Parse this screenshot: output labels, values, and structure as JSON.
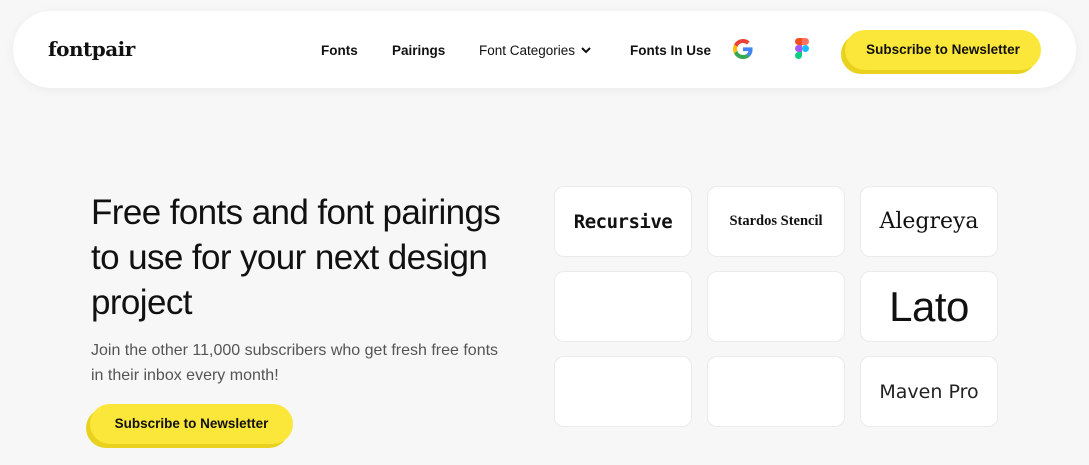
{
  "nav": {
    "logo": "fontpair",
    "links": [
      "Fonts",
      "Pairings",
      "Font Categories",
      "Fonts In Use"
    ],
    "subscribe_label": "Subscribe to Newsletter",
    "icons": [
      "google-icon",
      "figma-icon",
      "chevron-down-icon"
    ]
  },
  "hero": {
    "title": "Free fonts and font pairings to use for your next design project",
    "subtitle": "Join the other 11,000 subscribers who get fresh free fonts in their inbox every month!",
    "subscribe_label": "Subscribe to Newsletter"
  },
  "font_cards": [
    "Recursive",
    "Stardos Stencil",
    "Alegreya",
    "",
    "",
    "Lato",
    "",
    "",
    "Maven Pro"
  ],
  "colors": {
    "accent": "#fbe63a",
    "accent_shadow": "#e9d21e",
    "background": "#f7f7f7",
    "card": "#ffffff",
    "text": "#111111",
    "subtext": "#555555"
  }
}
